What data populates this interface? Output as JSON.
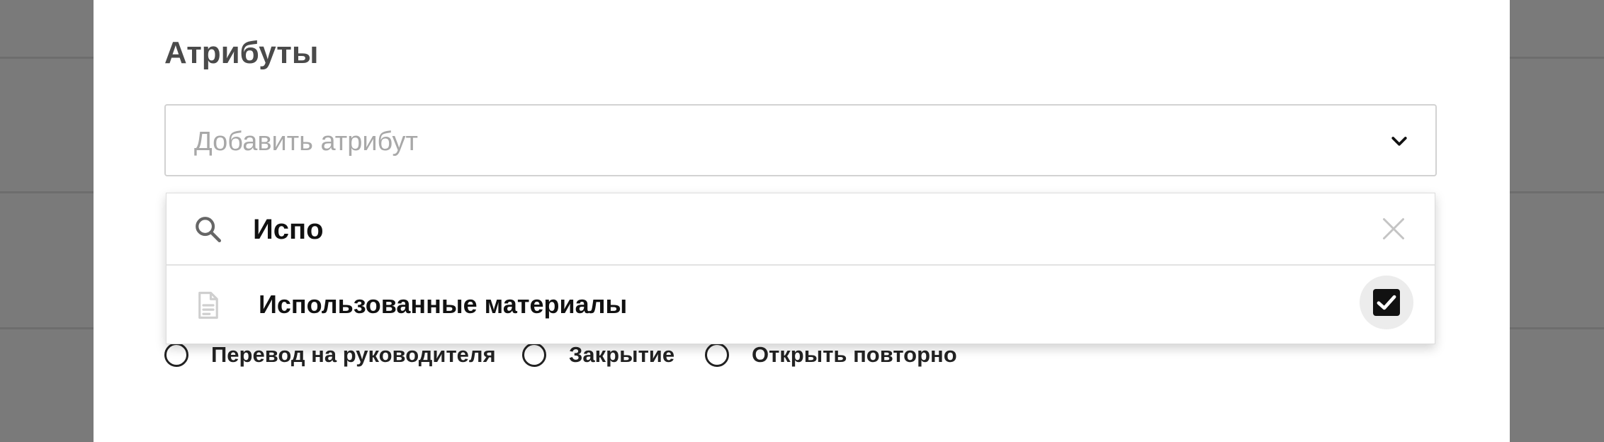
{
  "section": {
    "title": "Атрибуты"
  },
  "attribute_select": {
    "placeholder": "Добавить атрибут",
    "icon": "chevron-down-icon"
  },
  "dropdown": {
    "search": {
      "value": "Испо",
      "icon": "search-icon",
      "clear_icon": "close-icon"
    },
    "options": [
      {
        "label": "Использованные материалы",
        "icon": "document-icon",
        "checked": true
      }
    ]
  },
  "radio_options": [
    {
      "label": "Перевод на руководителя",
      "selected": false
    },
    {
      "label": "Закрытие",
      "selected": false
    },
    {
      "label": "Открыть повторно",
      "selected": false
    }
  ],
  "colors": {
    "backdrop": "#7a7a7a",
    "modal": "#ffffff",
    "checkbox": "#111111",
    "placeholder_text": "#a8a8a8"
  }
}
